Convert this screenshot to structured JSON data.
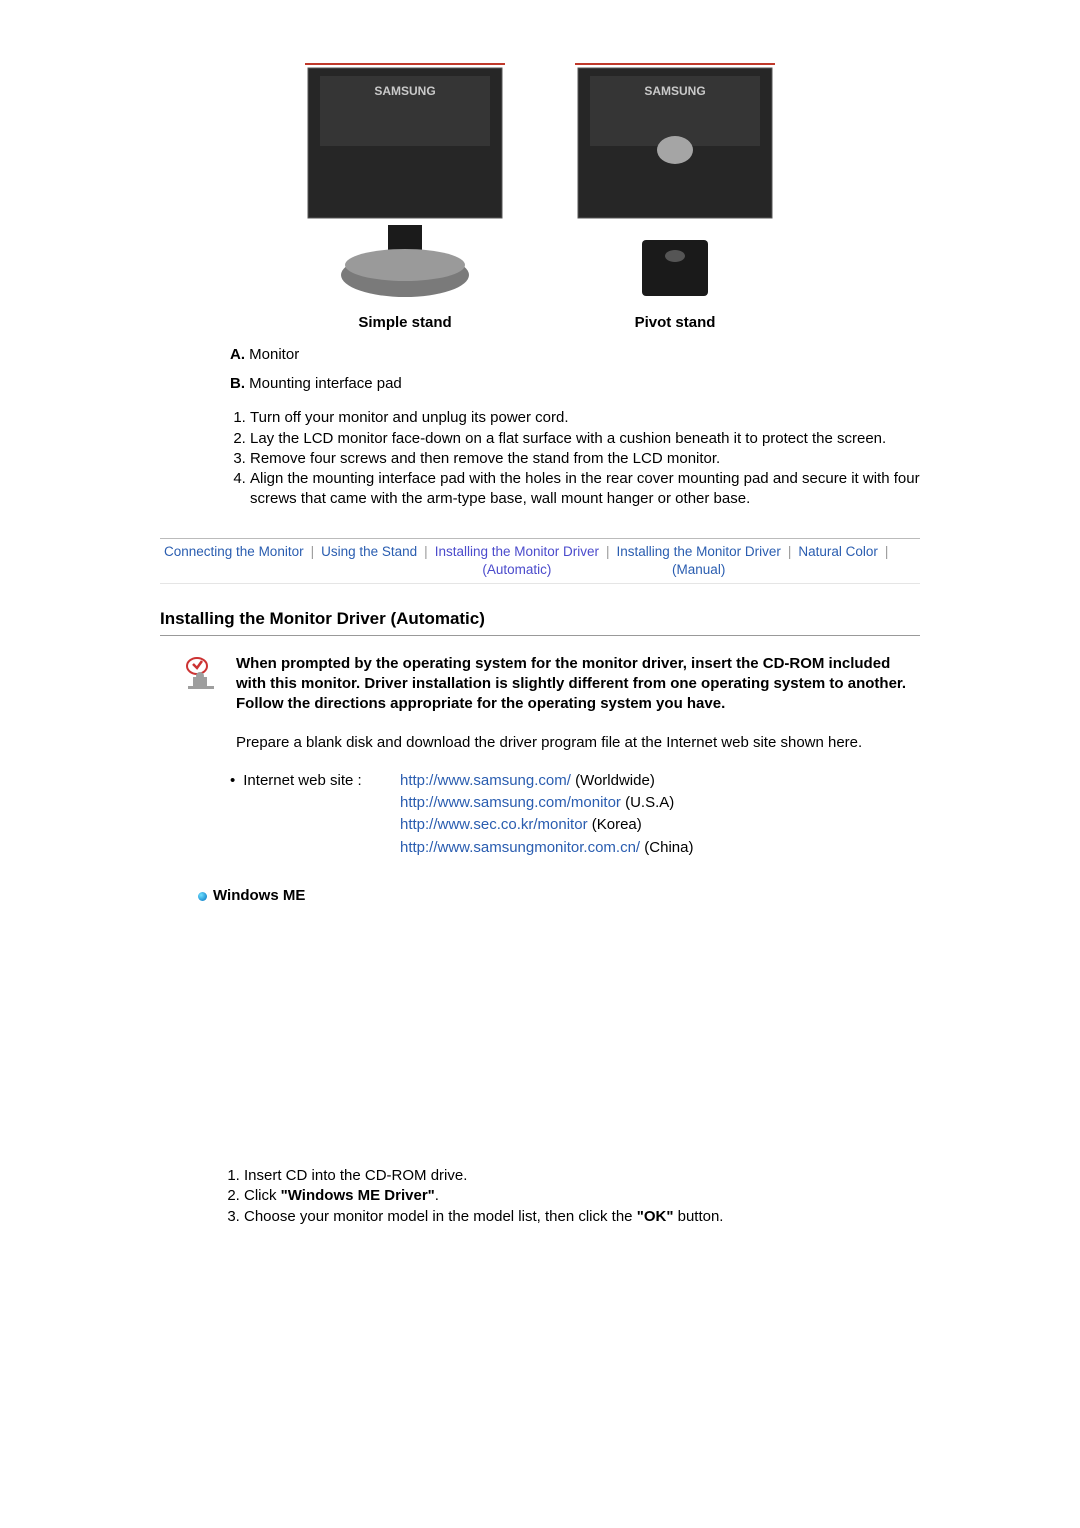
{
  "captions": {
    "simple": "Simple stand",
    "pivot": "Pivot stand"
  },
  "defs": {
    "a_label": "A.",
    "a_text": "Monitor",
    "b_label": "B.",
    "b_text": "Mounting interface pad"
  },
  "stand_steps": [
    "Turn off your monitor and unplug its power cord.",
    "Lay the LCD monitor face-down on a flat surface with a cushion beneath it to protect the screen.",
    "Remove four screws and then remove the stand from the LCD monitor.",
    "Align the mounting interface pad with the holes in the rear cover mounting pad and secure it with four screws that came with the arm-type base, wall mount hanger or other base."
  ],
  "tabs": {
    "connecting": "Connecting  the Monitor",
    "using_stand": "Using the Stand",
    "install_auto_l1": "Installing the Monitor Driver",
    "install_auto_l2": "(Automatic)",
    "install_man_l1": "Installing the Monitor Driver",
    "install_man_l2": "(Manual)",
    "natural_color": "Natural Color"
  },
  "section_title": "Installing the Monitor Driver (Automatic)",
  "note": {
    "bold": "When prompted by the operating system for the monitor driver, insert the CD-ROM included with this monitor. Driver installation is slightly different from one operating system to another. Follow the directions appropriate for the operating system you have.",
    "plain": "Prepare a blank disk and download the driver program file at the Internet web site shown here."
  },
  "sites": {
    "label": "Internet web site :",
    "links": [
      {
        "url": "http://www.samsung.com/",
        "region": "(Worldwide)"
      },
      {
        "url": "http://www.samsung.com/monitor",
        "region": "(U.S.A)"
      },
      {
        "url": "http://www.sec.co.kr/monitor",
        "region": "(Korea)"
      },
      {
        "url": "http://www.samsungmonitor.com.cn/",
        "region": "(China)"
      }
    ]
  },
  "os_heading": "Windows ME",
  "me_steps": {
    "s1": "Insert CD into the CD-ROM drive.",
    "s2a": "Click ",
    "s2b": "\"Windows ME Driver\"",
    "s2c": ".",
    "s3a": "Choose your monitor model in the model list, then click the ",
    "s3b": "\"OK\"",
    "s3c": " button."
  }
}
